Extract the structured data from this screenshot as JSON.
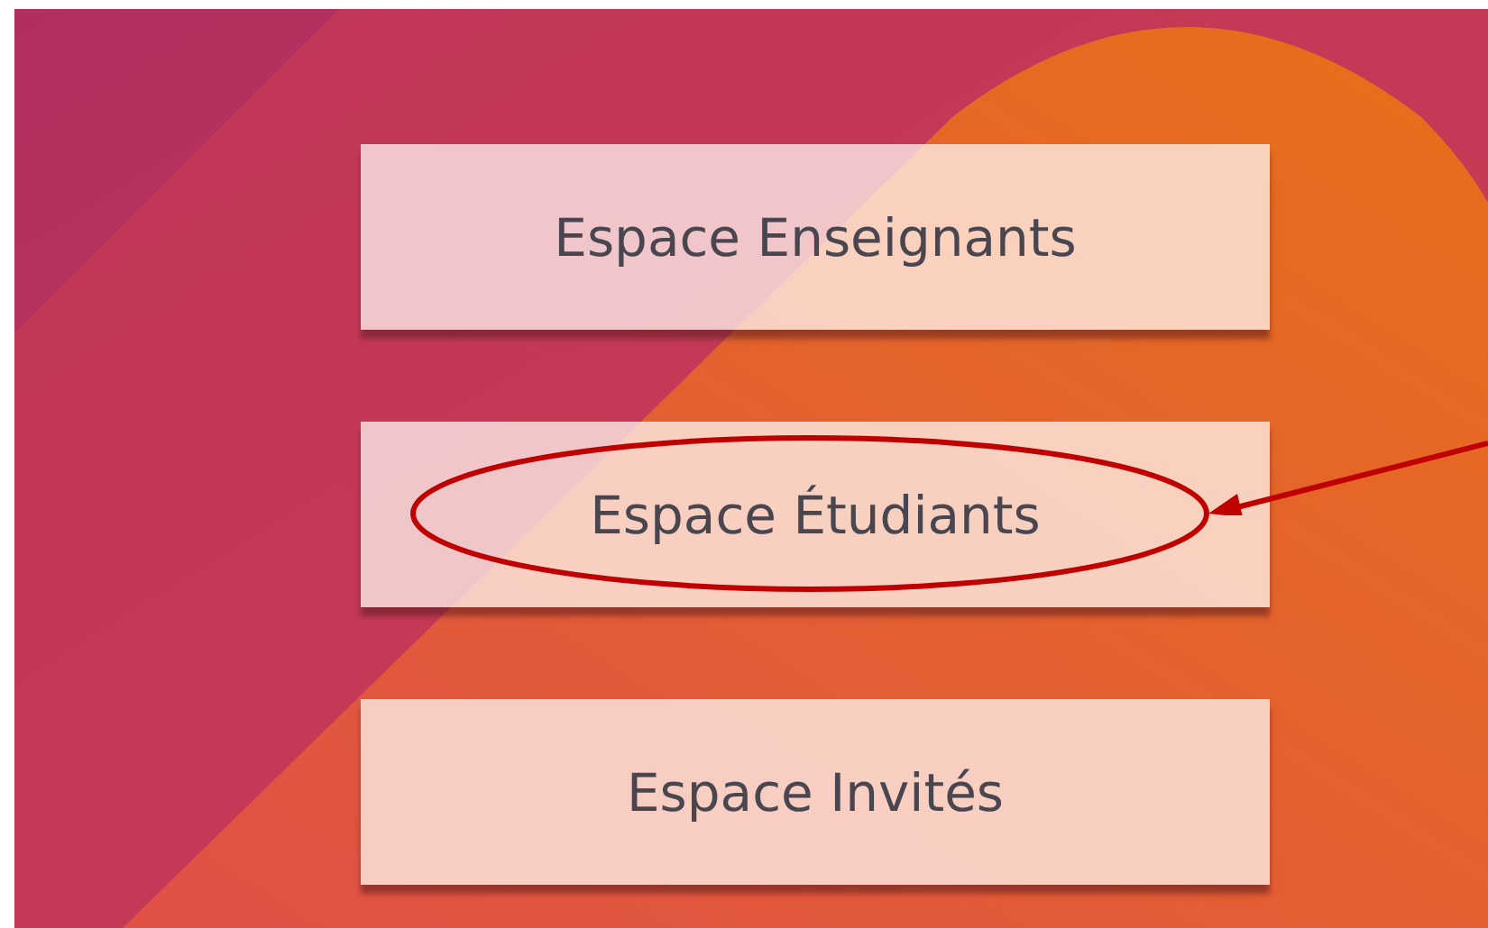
{
  "buttons": [
    {
      "label": "Espace Enseignants",
      "highlighted": false
    },
    {
      "label": "Espace Étudiants",
      "highlighted": true
    },
    {
      "label": "Espace Invités",
      "highlighted": false
    }
  ]
}
